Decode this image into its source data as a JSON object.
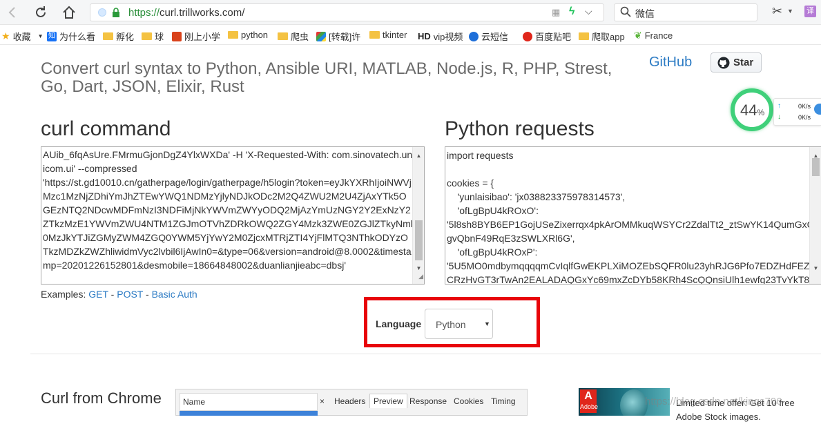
{
  "browser": {
    "url_scheme": "https://",
    "url_host": "curl.trillworks.com/",
    "search_text": "微信",
    "translate_label": "译"
  },
  "bookmarks": [
    {
      "label": "收藏",
      "icon": "star-icon"
    },
    {
      "label": "为什么看",
      "icon": "zhihu-icon"
    },
    {
      "label": "孵化",
      "icon": "folder-icon"
    },
    {
      "label": "球",
      "icon": "folder-icon"
    },
    {
      "label": "刚上小学",
      "icon": "site-icon"
    },
    {
      "label": "python",
      "icon": "folder-icon"
    },
    {
      "label": "爬虫",
      "icon": "folder-icon"
    },
    {
      "label": "[转载]许",
      "icon": "site-icon"
    },
    {
      "label": "tkinter",
      "icon": "folder-icon"
    },
    {
      "label": "vip视频",
      "icon": "hd-icon",
      "prefix": "HD"
    },
    {
      "label": "云短信",
      "icon": "site-icon"
    },
    {
      "label": "百度贴吧",
      "icon": "site-icon"
    },
    {
      "label": "爬取app",
      "icon": "folder-icon"
    },
    {
      "label": "France",
      "icon": "leaf-icon"
    }
  ],
  "page": {
    "title": "Convert curl syntax to Python, Ansible URI, MATLAB, Node.js, R, PHP, Strest, Go, Dart, JSON, Elixir, Rust",
    "github_link": "GitHub",
    "star_label": "Star",
    "curl_heading": "curl command",
    "python_heading": "Python requests",
    "curl_text": "AUib_6fqAsUre.FMrmuGjonDgZ4YlxWXDa' -H 'X-Requested-With: com.sinovatech.unicom.ui' --compressed\n'https://st.gd10010.cn/gatherpage/login/gatherpage/h5login?token=eyJkYXRhIjoiNWVjMzc1MzNjZDhiYmJhZTEwYWQ1NDMzYjlyNDJkODc2M2Q4ZWU2M2U4ZjAxYTk5OGEzNTQ2NDcwMDFmNzI3NDFiMjNkYWVmZWYyODQ2MjAzYmUzNGY2Y2ExNzY2ZTkzMzE1YWVmZWU4NTM1ZGJmOTVhZDRkOWQ2ZGY4Mzk3ZWE0ZGJlZTkyNml0MzJkYTJiZGMyZWM4ZGQ0YWM5YjYwY2M0ZjcxMTRjZTI4YjFlMTQ3NThkODYzOTkzMDZkZWZhliwidmVyc2lvbil6IjAwIn0=&type=06&version=android@8.0002&timestamp=20201226152801&desmobile=18664848002&duanlianjieabc=dbsj'",
    "python_text": "import requests\n\ncookies = {\n    'yunlaisibao': 'jx038823375978314573',\n    'ofLgBpU4kROxO':\n'5l8sh8BYB6EP1GojUSeZixerrqx4pkArOMMkuqWSYCr2ZdalTt2_ztSwYK14QumGxCgvQbnF49RqE3zSWLXRl6G',\n    'ofLgBpU4kROxP':\n'5U5MO0mdbymqqqqmCvIqlfGwEKPLXiMOZEbSQFR0lu23yhRJG6Pfo7EDZHdFEZCRzHvGT3rTwAn2EALADAQGxYc69mxZcDYb58KRh4ScQQnsiUlh1ewfg23TvYkT8",
    "examples_label": "Examples:",
    "example_links": [
      "GET",
      "POST",
      "Basic Auth"
    ],
    "language_label": "Language",
    "language_value": "Python",
    "curl_from_chrome": "Curl from Chrome"
  },
  "speed_widget": {
    "percent": "44",
    "percent_unit": "%",
    "up_speed": "0K/s",
    "down_speed": "0K/s"
  },
  "devtools": {
    "name_col": "Name",
    "close": "×",
    "tabs": [
      "Headers",
      "Preview",
      "Response",
      "Cookies",
      "Timing"
    ],
    "active_tab": "Preview"
  },
  "ad": {
    "brand": "Adobe",
    "text": "Limited time offer: Get 10 free Adobe Stock images.",
    "watermark": "https://blog.csdn.net/kinqs706"
  },
  "colors": {
    "link": "#2c7bc4",
    "highlight_frame": "#e8050a",
    "speed_ring": "#3fd07a"
  }
}
